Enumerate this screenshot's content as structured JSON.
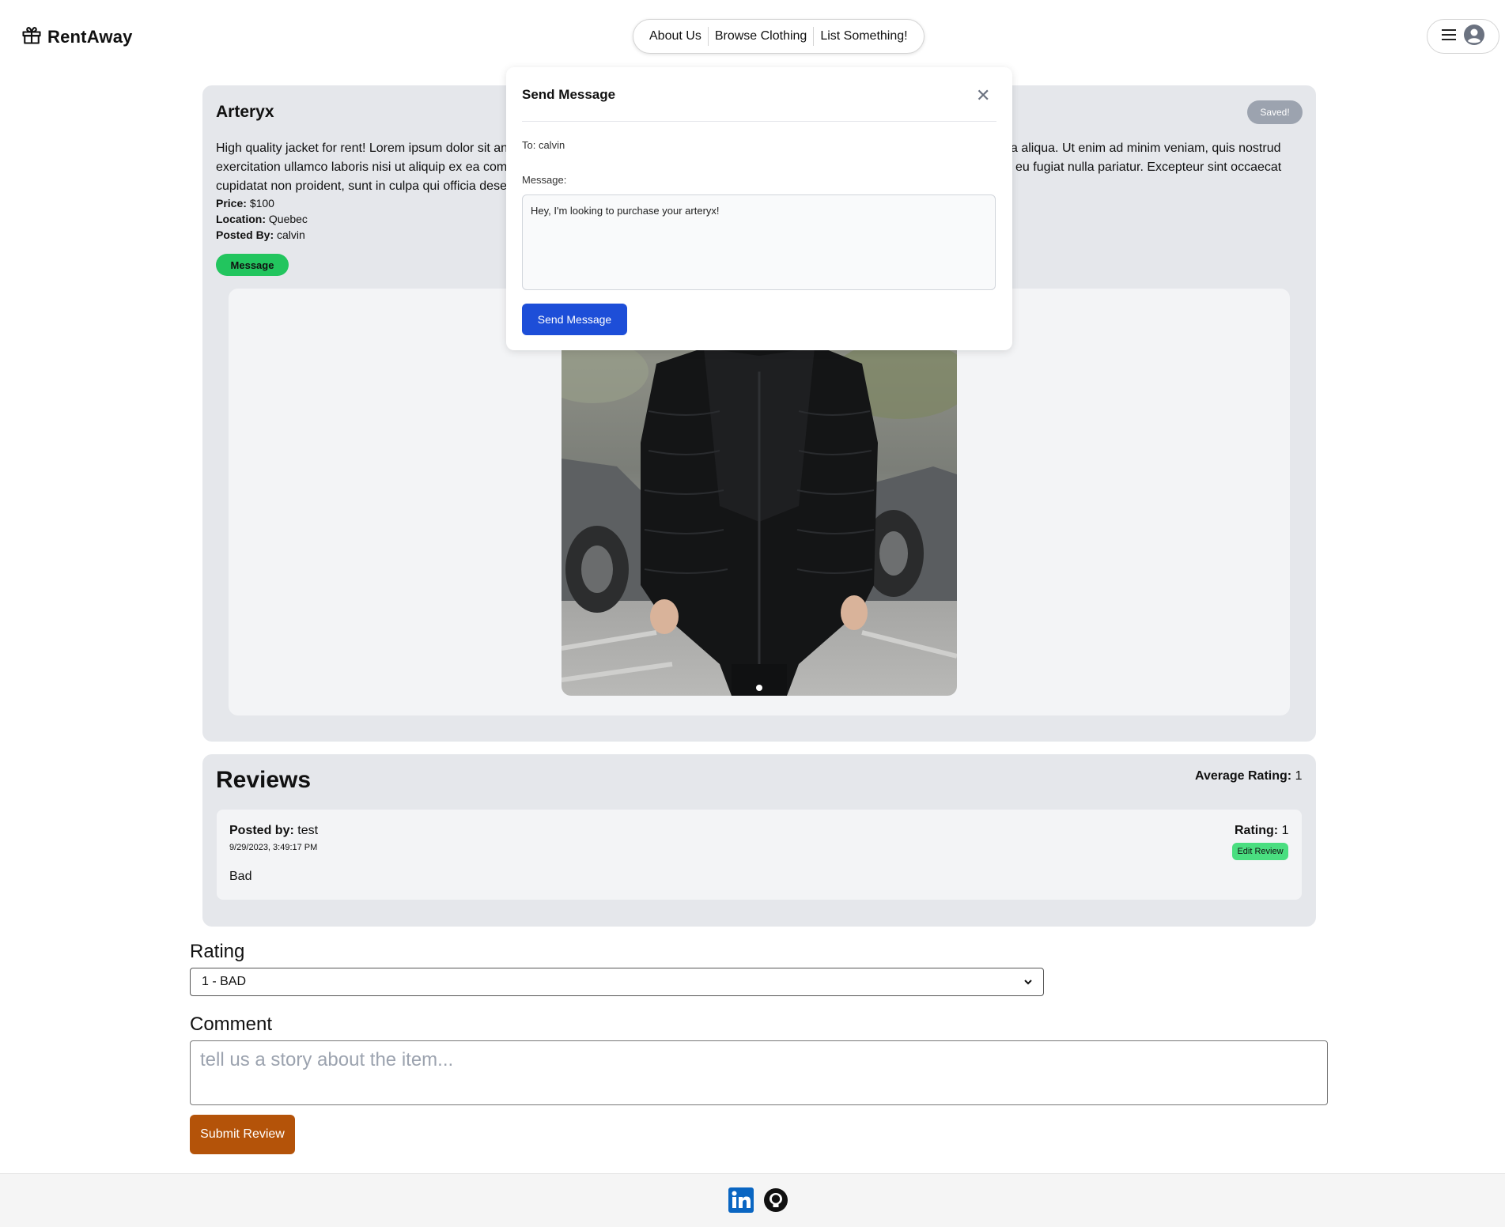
{
  "header": {
    "app_name": "RentAway",
    "nav": [
      "About Us",
      "Browse Clothing",
      "List Something!"
    ]
  },
  "item": {
    "title": "Arteryx",
    "saved_badge": "Saved!",
    "description_left": "High quality jacket for rent! Lorem ipsum dolor sit an",
    "description_line2_left": "exercitation ullamco laboris nisi ut aliquip ex ea com",
    "description_line3_left": "cupidatat non proident, sunt in culpa qui officia dese",
    "description_right": "a aliqua. Ut enim ad minim veniam, quis nostrud",
    "description_line2_right": "eu fugiat nulla pariatur. Excepteur sint occaecat",
    "price_label": "Price:",
    "price": "$100",
    "location_label": "Location:",
    "location": "Quebec",
    "posted_by_label": "Posted By:",
    "posted_by": "calvin",
    "message_button": "Message"
  },
  "modal": {
    "title": "Send Message",
    "to": "To: calvin",
    "message_label": "Message:",
    "message_value": "Hey, I'm looking to purchase your arteryx!",
    "send_button": "Send Message"
  },
  "reviews": {
    "title": "Reviews",
    "avg_label": "Average Rating:",
    "avg_value": "1",
    "items": [
      {
        "posted_by_label": "Posted by:",
        "posted_by": "test",
        "date": "9/29/2023, 3:49:17 PM",
        "text": "Bad",
        "rating_label": "Rating:",
        "rating": "1",
        "edit_button": "Edit Review"
      }
    ]
  },
  "review_form": {
    "rating_label": "Rating",
    "rating_selected": "1 - BAD",
    "comment_label": "Comment",
    "comment_placeholder": "tell us a story about the item...",
    "submit_button": "Submit Review"
  },
  "footer": {
    "icons": [
      "linkedin-icon",
      "github-icon"
    ]
  },
  "colors": {
    "message_button": "#22c55e",
    "send_button": "#1d4ed8",
    "submit_button": "#b45309",
    "edit_button": "#4ade80",
    "saved_badge": "#9ca3af",
    "card_bg": "#e5e7eb"
  }
}
